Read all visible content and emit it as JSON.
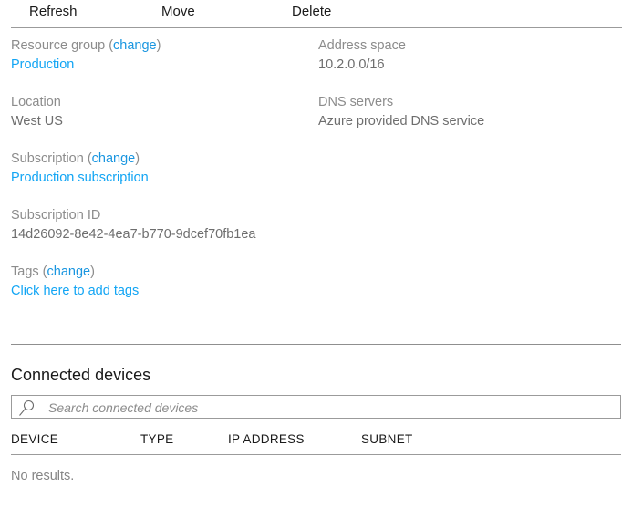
{
  "toolbar": {
    "refresh_label": "Refresh",
    "move_label": "Move",
    "delete_label": "Delete"
  },
  "properties": {
    "left_column": [
      {
        "label": "Resource group",
        "change_label": "change",
        "has_change": true,
        "value": "Production",
        "value_is_link": true
      },
      {
        "label": "Location",
        "has_change": false,
        "value": "West US",
        "value_is_link": false
      },
      {
        "label": "Subscription",
        "change_label": "change",
        "has_change": true,
        "value": "Production subscription",
        "value_is_link": true
      },
      {
        "label": "Subscription  ID",
        "has_change": false,
        "value": "14d26092-8e42-4ea7-b770-9dcef70fb1ea",
        "value_is_link": false
      },
      {
        "label": "Tags",
        "change_label": "change",
        "has_change": true,
        "value": "Click here to add tags",
        "value_is_link": true
      }
    ],
    "right_column": [
      {
        "label": "Address space",
        "has_change": false,
        "value": "10.2.0.0/16",
        "value_is_link": false
      },
      {
        "label": "DNS servers",
        "has_change": false,
        "value": "Azure provided DNS service",
        "value_is_link": false
      }
    ]
  },
  "connected_devices": {
    "title": "Connected devices",
    "search": {
      "placeholder": "Search connected devices",
      "value": "",
      "icon": "search-icon"
    },
    "table": {
      "columns": [
        "DEVICE",
        "TYPE",
        "IP ADDRESS",
        "SUBNET"
      ],
      "rows": [],
      "empty_message": "No results."
    }
  },
  "colors": {
    "link": "#12a5f4",
    "change_link": "#1a96e0",
    "label_gray": "#8c8c8c",
    "value_gray": "#6e6e6e",
    "rule": "#9b9b9b",
    "text_dark": "#1a1a1a",
    "background": "#ffffff"
  }
}
